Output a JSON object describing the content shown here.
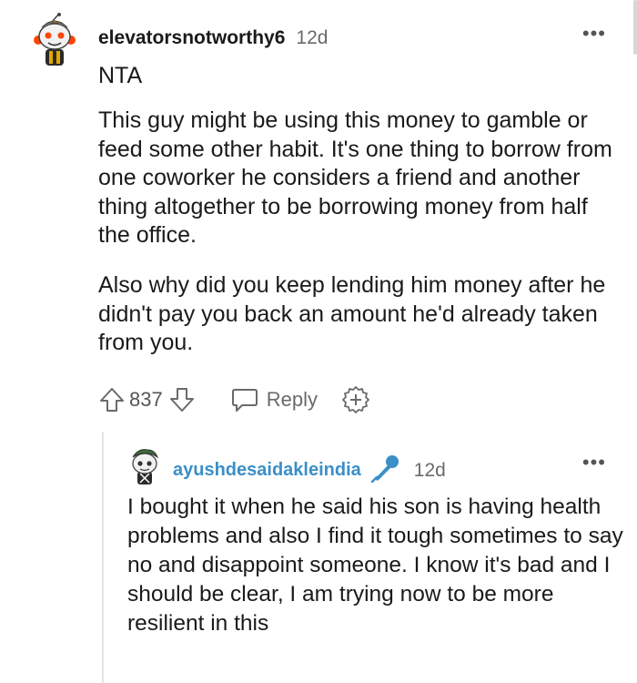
{
  "comment": {
    "username": "elevatorsnotworthy6",
    "timestamp": "12d",
    "more_icon": "more-options-icon",
    "more_label": "•••",
    "title_line": "NTA",
    "paragraph_1": "This guy might be using this money to gamble or feed some other habit. It's one thing to borrow from one coworker he considers a friend and another thing altogether to be borrowing money from half the office.",
    "paragraph_2": "Also why did you keep lending him money after he didn't pay you back an amount he'd already taken from you.",
    "vote_count": "837",
    "reply_label": "Reply",
    "icons": [
      "upvote-icon",
      "downvote-icon",
      "reply-icon",
      "award-icon"
    ]
  },
  "reply": {
    "username": "ayushdesaidakleindia",
    "flair_icon": "microphone-icon",
    "timestamp": "12d",
    "more_label": "•••",
    "text": "I bought it when he said his son is having health problems and also I find it tough sometimes to say no and disappoint someone. I know it's bad and I should be clear, I am trying now to be more resilient in this"
  },
  "colors": {
    "username_reply": "#3a8fc8",
    "flair_icon": "#3a8fc8",
    "muted_text": "#6a6a6a",
    "thread_line": "#e4e4e4"
  }
}
